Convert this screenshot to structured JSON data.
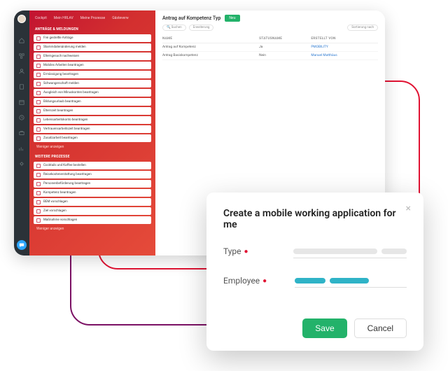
{
  "rail": {
    "icons": [
      "home",
      "org",
      "user",
      "doc",
      "calendar",
      "clock",
      "briefcase",
      "chart",
      "settings"
    ]
  },
  "topnav": {
    "items": [
      "Cockpit",
      "Mein HRLAV",
      "Meine Prozesse",
      "Gästeverw"
    ]
  },
  "sidebar": {
    "section1_title": "ANTRÄGE & MELDUNGEN",
    "section1": [
      "Frei gestellte Anträge",
      "Stammdatenänderung melden",
      "Elterngesuch nachweisen",
      "Mobiles Arbeiten beantragen",
      "Ermässigung beantragen",
      "Schwangerschaft melden",
      "Ausgleich von Minuskonten beantragen",
      "Bildungsurlaub beantragen",
      "Elternzeit beantragen",
      "Lebensarbeitskonto beantragen",
      "Vertrauensarbeitszeit beantragen",
      "Zusatzarbeit beantragen"
    ],
    "section1_more": "Weniger anzeigen",
    "section2_title": "WEITERE PROZESSE",
    "section2": [
      "Cocktails und Kaffee bestellen",
      "Reisekostenerstattung beantragen",
      "Personenbeförderung beantragen",
      "Kompetenz beantragen",
      "BEM vorschlagen",
      "Ziel vorschlagen",
      "Maßnahme vorschlagen"
    ],
    "section2_more": "Weniger anzeigen"
  },
  "main": {
    "title": "Antrag auf Kompetenz Typ",
    "new_btn": "Neu",
    "tools": {
      "search": "Suchen",
      "filter": "Erweiterung",
      "sort": "Sortierung nach"
    },
    "columns": [
      "NAME",
      "STATUSNAME",
      "ERSTELLT VON"
    ],
    "rows": [
      {
        "name": "Antrag auf Kompetenz",
        "status": "Ja",
        "by": "PMOBILITY"
      },
      {
        "name": "Antrag Basiskompetenz",
        "status": "Nein",
        "by": "Manuel Matthäus"
      }
    ]
  },
  "modal": {
    "title": "Create a mobile working application for me",
    "type_label": "Type",
    "employee_label": "Employee",
    "save": "Save",
    "cancel": "Cancel"
  }
}
